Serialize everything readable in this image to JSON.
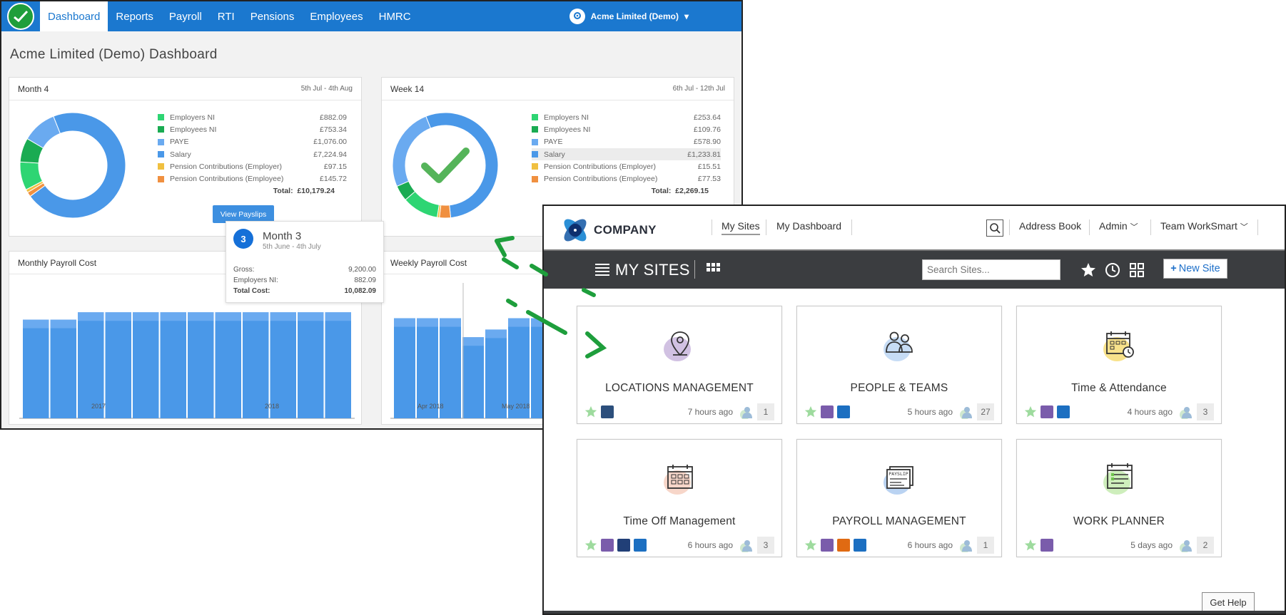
{
  "payroll_app": {
    "nav": {
      "tabs": [
        "Dashboard",
        "Reports",
        "Payroll",
        "RTI",
        "Pensions",
        "Employees",
        "HMRC"
      ],
      "active": "Dashboard",
      "company": "Acme Limited (Demo)"
    },
    "page_title": "Acme Limited (Demo) Dashboard",
    "month_card": {
      "title": "Month 4",
      "range": "5th Jul - 4th Aug",
      "items": [
        {
          "label": "Employers NI",
          "value": "£882.09",
          "color": "#2ed573"
        },
        {
          "label": "Employees NI",
          "value": "£753.34",
          "color": "#1aab52"
        },
        {
          "label": "PAYE",
          "value": "£1,076.00",
          "color": "#6aaaf0"
        },
        {
          "label": "Salary",
          "value": "£7,224.94",
          "color": "#4a98e8"
        },
        {
          "label": "Pension Contributions (Employer)",
          "value": "£97.15",
          "color": "#f0c040"
        },
        {
          "label": "Pension Contributions (Employee)",
          "value": "£145.72",
          "color": "#f09040"
        }
      ],
      "total_label": "Total:",
      "total": "£10,179.24",
      "button": "View Payslips"
    },
    "week_card": {
      "title": "Week 14",
      "range": "6th Jul - 12th Jul",
      "items": [
        {
          "label": "Employers NI",
          "value": "£253.64",
          "color": "#2ed573"
        },
        {
          "label": "Employees NI",
          "value": "£109.76",
          "color": "#1aab52"
        },
        {
          "label": "PAYE",
          "value": "£578.90",
          "color": "#6aaaf0"
        },
        {
          "label": "Salary",
          "value": "£1,233.81",
          "color": "#4a98e8"
        },
        {
          "label": "Pension Contributions (Employer)",
          "value": "£15.51",
          "color": "#f0c040"
        },
        {
          "label": "Pension Contributions (Employee)",
          "value": "£77.53",
          "color": "#f09040"
        }
      ],
      "highlight": "Salary",
      "total_label": "Total:",
      "total": "£2,269.15"
    },
    "monthly_cost": {
      "title": "Monthly Payroll Cost",
      "x_labels": [
        "2017",
        "2018"
      ]
    },
    "weekly_cost": {
      "title": "Weekly Payroll Cost",
      "x_labels": [
        "Apr 2018",
        "May 2018"
      ]
    },
    "tooltip": {
      "badge": "3",
      "title": "Month 3",
      "range": "5th June - 4th July",
      "rows": [
        {
          "label": "Gross:",
          "value": "9,200.00"
        },
        {
          "label": "Employers NI:",
          "value": "882.09"
        },
        {
          "label": "Total Cost:",
          "value": "10,082.09"
        }
      ]
    }
  },
  "company_app": {
    "logo_text": "COMPANY",
    "nav": [
      "My Sites",
      "My Dashboard"
    ],
    "right_nav": [
      "Address Book",
      "Admin",
      "Team WorkSmart"
    ],
    "section_title": "MY SITES",
    "search_placeholder": "Search Sites...",
    "new_site": "New Site",
    "get_help": "Get Help",
    "tiles": [
      {
        "name": "LOCATIONS MANAGEMENT",
        "time": "7 hours ago",
        "count": "1",
        "tags": [
          "#2c4f7c"
        ],
        "icon": "location-pin-icon",
        "blob": "#c9b6dd"
      },
      {
        "name": "PEOPLE & TEAMS",
        "time": "5 hours ago",
        "count": "27",
        "tags": [
          "#7a5cab",
          "#1c6fc1"
        ],
        "icon": "people-icon",
        "blob": "#bcd6f3"
      },
      {
        "name": "Time & Attendance",
        "time": "4 hours ago",
        "count": "3",
        "tags": [
          "#7a5cab",
          "#1c6fc1"
        ],
        "icon": "calendar-clock-icon",
        "blob": "#f7dd77"
      },
      {
        "name": "Time Off Management",
        "time": "6 hours ago",
        "count": "3",
        "tags": [
          "#7a5cab",
          "#213f77",
          "#1c6fc1"
        ],
        "icon": "calendar-icon",
        "blob": "#f6cfc0"
      },
      {
        "name": "PAYROLL MANAGEMENT",
        "time": "6 hours ago",
        "count": "1",
        "tags": [
          "#7a5cab",
          "#e06a12",
          "#1c6fc1"
        ],
        "icon": "payslip-icon",
        "blob": "#aecbf0"
      },
      {
        "name": "WORK PLANNER",
        "time": "5 days ago",
        "count": "2",
        "tags": [
          "#7a5cab"
        ],
        "icon": "planner-icon",
        "blob": "#c5ebb0"
      }
    ]
  },
  "chart_data": [
    {
      "type": "bar",
      "title": "Monthly Payroll Cost",
      "categories": [
        "",
        "",
        "",
        "",
        "",
        "",
        "",
        "",
        "",
        "",
        "",
        ""
      ],
      "x_tick_labels": [
        "2017",
        "2018"
      ],
      "series": [
        {
          "values": [
            9400,
            9400,
            10100,
            10100,
            10100,
            10100,
            10100,
            10100,
            10100,
            10100,
            10100,
            10100
          ]
        }
      ],
      "ylim": [
        0,
        11000
      ]
    },
    {
      "type": "bar",
      "title": "Weekly Payroll Cost",
      "categories": [
        "",
        "",
        "",
        "",
        "",
        "",
        ""
      ],
      "x_tick_labels": [
        "Apr 2018",
        "May 2018"
      ],
      "series": [
        {
          "values": [
            1950,
            1950,
            1950,
            1580,
            1730,
            1950,
            1950
          ]
        }
      ],
      "ylim": [
        0,
        2250
      ]
    }
  ]
}
